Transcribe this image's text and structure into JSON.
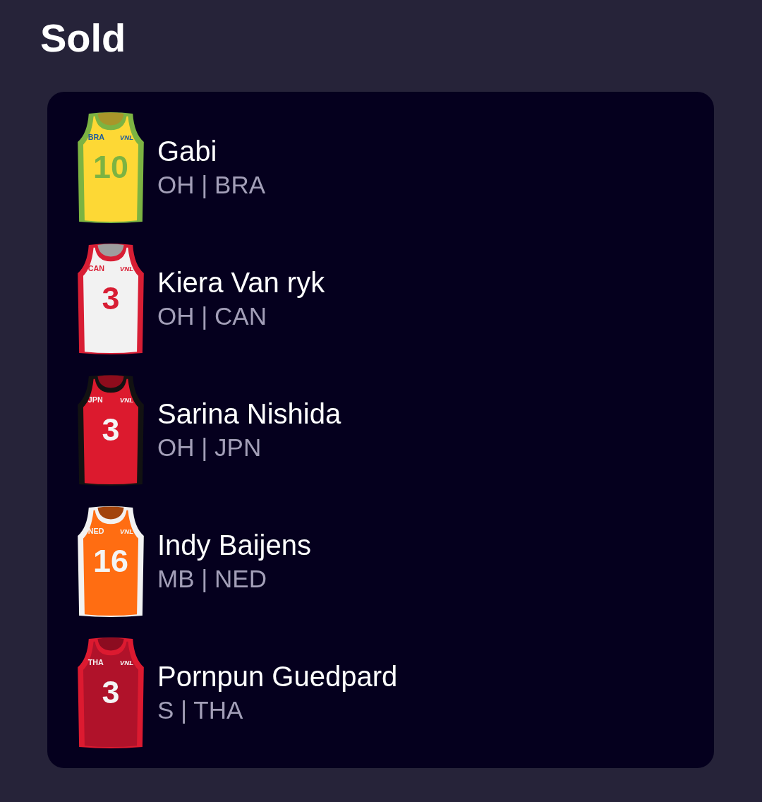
{
  "title": "Sold",
  "players": [
    {
      "name": "Gabi",
      "details": "OH | BRA",
      "jersey": {
        "color": "#fdd835",
        "trim": {
          "color": "#7cb342"
        },
        "collar": {
          "color": "#a8962a"
        },
        "code": {
          "text": "BRA",
          "color": "#1f5c9e"
        },
        "logo": "VNL",
        "number": {
          "text": "10",
          "color": "#7cb342"
        }
      }
    },
    {
      "name": "Kiera Van ryk",
      "details": "OH | CAN",
      "jersey": {
        "color": "#f2f2f2",
        "trim": {
          "color": "#d81e34"
        },
        "collar": {
          "color": "#9e9e9e"
        },
        "code": {
          "text": "CAN",
          "color": "#d81e34"
        },
        "logo": "VNL",
        "number": {
          "text": "3",
          "color": "#d81e34"
        }
      }
    },
    {
      "name": "Sarina Nishida",
      "details": "OH | JPN",
      "jersey": {
        "color": "#dc1a2e",
        "trim": {
          "color": "#121212"
        },
        "collar": {
          "color": "#8e0c1c"
        },
        "code": {
          "text": "JPN",
          "color": "#f4f4f4"
        },
        "logo": "VNL",
        "number": {
          "text": "3",
          "color": "#f4f4f4"
        }
      }
    },
    {
      "name": "Indy Baijens",
      "details": "MB | NED",
      "jersey": {
        "color": "#ff6d12",
        "trim": {
          "color": "#f2f2f2"
        },
        "collar": {
          "color": "#a3440c"
        },
        "code": {
          "text": "NED",
          "color": "#f4f4f4"
        },
        "logo": "VNL",
        "number": {
          "text": "16",
          "color": "#f4f4f4"
        }
      }
    },
    {
      "name": "Pornpun Guedpard",
      "details": "S | THA",
      "jersey": {
        "color": "#b0122a",
        "trim": {
          "color": "#dc1a30"
        },
        "collar": {
          "color": "#8c0c20"
        },
        "code": {
          "text": "THA",
          "color": "#f4f4f4"
        },
        "logo": "VNL",
        "number": {
          "text": "3",
          "color": "#f4f4f4"
        }
      }
    }
  ]
}
